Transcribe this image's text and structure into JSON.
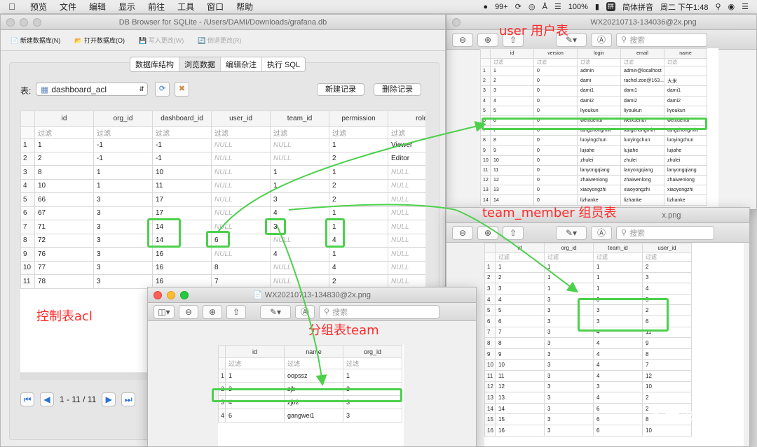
{
  "menubar": {
    "apple": "",
    "items": [
      "预览",
      "文件",
      "编辑",
      "显示",
      "前往",
      "工具",
      "窗口",
      "帮助"
    ],
    "status": [
      "99+",
      "100%",
      "简体拼音",
      "周二 下午1:48"
    ],
    "input_badge": "拼"
  },
  "db": {
    "title": "DB Browser for SQLite - /Users/DAMI/Downloads/grafana.db",
    "toolbar": [
      "新建数据库(N)",
      "打开数据库(O)",
      "写入更改(W)",
      "倒退更改(R)"
    ],
    "tabs": [
      "数据库结构",
      "浏览数据",
      "编辑杂注",
      "执行 SQL"
    ],
    "table_label": "表:",
    "table_select": "dashboard_acl",
    "new_record": "新建记录",
    "delete_record": "删除记录",
    "columns": [
      "id",
      "org_id",
      "dashboard_id",
      "user_id",
      "team_id",
      "permission",
      "role"
    ],
    "filter": "过滤",
    "rows": [
      [
        "1",
        "1",
        "-1",
        "-1",
        "NULL",
        "NULL",
        "1",
        "Viewer"
      ],
      [
        "2",
        "2",
        "-1",
        "-1",
        "NULL",
        "NULL",
        "2",
        "Editor"
      ],
      [
        "3",
        "8",
        "1",
        "10",
        "NULL",
        "1",
        "1",
        "NULL"
      ],
      [
        "4",
        "10",
        "1",
        "11",
        "NULL",
        "1",
        "2",
        "NULL"
      ],
      [
        "5",
        "66",
        "3",
        "17",
        "NULL",
        "3",
        "2",
        "NULL"
      ],
      [
        "6",
        "67",
        "3",
        "17",
        "NULL",
        "4",
        "1",
        "NULL"
      ],
      [
        "7",
        "71",
        "3",
        "14",
        "NULL",
        "3",
        "1",
        "NULL"
      ],
      [
        "8",
        "72",
        "3",
        "14",
        "6",
        "NULL",
        "4",
        "NULL"
      ],
      [
        "9",
        "76",
        "3",
        "16",
        "NULL",
        "4",
        "1",
        "NULL"
      ],
      [
        "10",
        "77",
        "3",
        "16",
        "8",
        "NULL",
        "4",
        "NULL"
      ],
      [
        "11",
        "78",
        "3",
        "16",
        "7",
        "NULL",
        "2",
        "NULL"
      ]
    ],
    "pager": "1 - 11 / 11"
  },
  "user_win": {
    "title": "WX20210713-134036@2x.png",
    "search": "搜索",
    "columns": [
      "id",
      "version",
      "login",
      "email",
      "name"
    ],
    "filter": "过滤",
    "rows": [
      [
        "1",
        "1",
        "0",
        "admin",
        "admin@localhost",
        ""
      ],
      [
        "2",
        "2",
        "0",
        "dami",
        "rachel.zoe@163...",
        "大米"
      ],
      [
        "3",
        "3",
        "0",
        "dami1",
        "dami1",
        "dami1"
      ],
      [
        "4",
        "4",
        "0",
        "dami2",
        "dami2",
        "dami2"
      ],
      [
        "5",
        "5",
        "0",
        "liyoukun",
        "liyoukun",
        "liyoukun"
      ],
      [
        "6",
        "6",
        "0",
        "weixuehui",
        "weixuehui",
        "weixuehui"
      ],
      [
        "7",
        "7",
        "0",
        "tangzhongmin",
        "tangzhongmin",
        "tangzhongmin"
      ],
      [
        "8",
        "8",
        "0",
        "luoyingchun",
        "luoyingchun",
        "luoyingchun"
      ],
      [
        "9",
        "9",
        "0",
        "lujiahe",
        "lujiahe",
        "lujiahe"
      ],
      [
        "10",
        "10",
        "0",
        "zhulei",
        "zhulei",
        "zhulei"
      ],
      [
        "11",
        "11",
        "0",
        "lanyongqiang",
        "lanyongqiang",
        "lanyongqiang"
      ],
      [
        "12",
        "12",
        "0",
        "zhaiwenlong",
        "zhaiwenlong",
        "zhaiwenlong"
      ],
      [
        "13",
        "13",
        "0",
        "xiaoyongzhi",
        "xiaoyongzhi",
        "xiaoyongzhi"
      ],
      [
        "14",
        "14",
        "0",
        "lizhanke",
        "lizhanke",
        "lizhanke"
      ]
    ]
  },
  "member_win": {
    "title": "x.png",
    "search": "搜索",
    "columns": [
      "id",
      "org_id",
      "team_id",
      "user_id"
    ],
    "filter": "过滤",
    "rows": [
      [
        "1",
        "1",
        "1",
        "1",
        "2"
      ],
      [
        "2",
        "2",
        "1",
        "1",
        "3"
      ],
      [
        "3",
        "3",
        "1",
        "1",
        "4"
      ],
      [
        "4",
        "4",
        "3",
        "3",
        "5"
      ],
      [
        "5",
        "5",
        "3",
        "3",
        "2"
      ],
      [
        "6",
        "6",
        "3",
        "3",
        "6"
      ],
      [
        "7",
        "7",
        "3",
        "4",
        "11"
      ],
      [
        "8",
        "8",
        "3",
        "4",
        "9"
      ],
      [
        "9",
        "9",
        "3",
        "4",
        "8"
      ],
      [
        "10",
        "10",
        "3",
        "4",
        "7"
      ],
      [
        "11",
        "11",
        "3",
        "4",
        "12"
      ],
      [
        "12",
        "12",
        "3",
        "3",
        "10"
      ],
      [
        "13",
        "13",
        "3",
        "4",
        "2"
      ],
      [
        "14",
        "14",
        "3",
        "6",
        "2"
      ],
      [
        "15",
        "15",
        "3",
        "6",
        "8"
      ],
      [
        "16",
        "16",
        "3",
        "6",
        "10"
      ]
    ]
  },
  "team_win": {
    "title": "WX20210713-134830@2x.png",
    "search": "搜索",
    "columns": [
      "id",
      "name",
      "org_id"
    ],
    "filter": "过滤",
    "rows": [
      [
        "1",
        "1",
        "oopssz",
        "1"
      ],
      [
        "2",
        "3",
        "zjb",
        "3"
      ],
      [
        "3",
        "4",
        "zjb2",
        "3"
      ],
      [
        "4",
        "6",
        "gangwei1",
        "3"
      ]
    ]
  },
  "annotations": {
    "user": "user 用户表",
    "member": "team_member 组员表",
    "acl": "控制表acl",
    "team": "分组表team"
  },
  "watermark": "大米谭",
  "colors": {
    "highlight": "#4cd04c",
    "annotation": "#ff2a2a"
  }
}
